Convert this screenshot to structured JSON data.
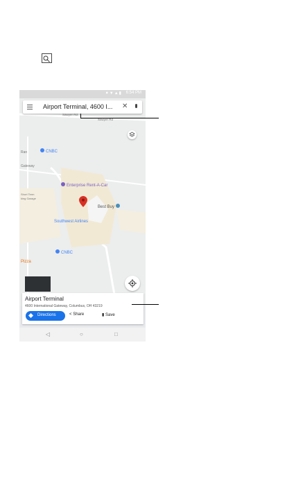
{
  "search": {
    "query": "Airport Terminal, 4600 I..."
  },
  "status": {
    "time": "6:54 PM"
  },
  "map": {
    "roads": [
      "Sawyer Rd",
      "Sawyer Rd"
    ],
    "pois": [
      {
        "name": "CNBC",
        "color": "#4285f4"
      },
      {
        "name": "Enterprise Rent-A-Car",
        "color": "#7b61c2"
      },
      {
        "name": "Best Buy",
        "color": "#4a90b8"
      },
      {
        "name": "Southwest Airlines",
        "color": "#4285f4"
      },
      {
        "name": "CNBC",
        "color": "#4285f4"
      }
    ],
    "edge_labels": [
      "Ran",
      "Gateway",
      "Short Term",
      "king Garage",
      "Pizza"
    ]
  },
  "place": {
    "title": "Airport Terminal",
    "address": "4600 International Gateway, Columbus, OH 43219",
    "actions": {
      "directions": "Directions",
      "share": "Share",
      "save": "Save"
    }
  },
  "colors": {
    "accent": "#1a73e8",
    "pin": "#d93025"
  }
}
